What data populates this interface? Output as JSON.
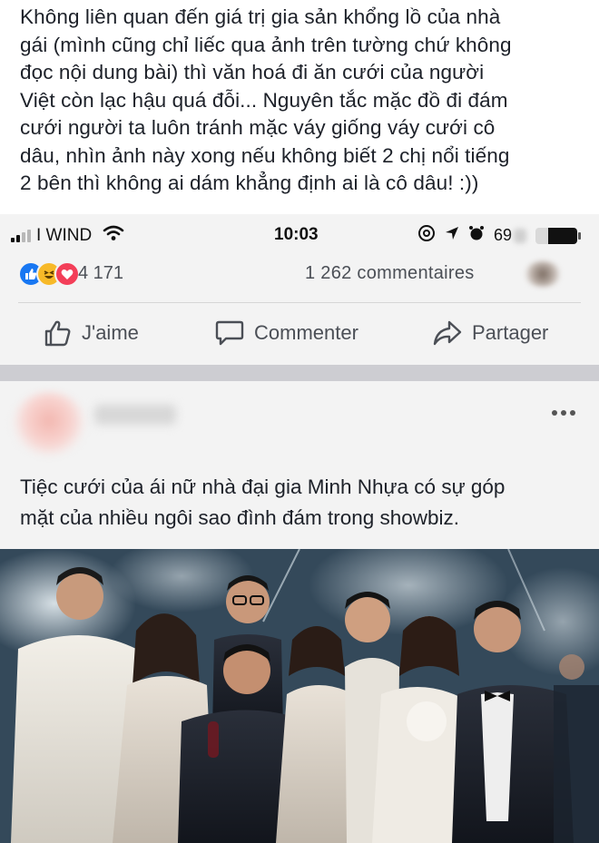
{
  "caption": {
    "line1": "Không liên quan đến giá trị gia sản khổng lồ của nhà",
    "line2": "gái (mình cũng chỉ liếc qua ảnh trên tường chứ không",
    "line3": "đọc nội dung bài) thì văn hoá đi ăn cưới của người",
    "line4": "Việt còn lạc hậu quá đỗi... Nguyên tắc mặc đồ đi đám",
    "line5": "cưới người ta luôn tránh mặc váy giống váy cưới cô",
    "line6": "dâu, nhìn ảnh này xong nếu không biết 2 chị nổi tiếng",
    "line7": "2 bên thì không ai dám khẳng định ai là cô dâu! :))"
  },
  "status_bar": {
    "carrier": "I WIND",
    "time": "10:03",
    "battery_text": "69",
    "icons": [
      "signal-icon",
      "wifi-icon",
      "at-icon",
      "location-arrow-icon",
      "alarm-icon",
      "battery-icon"
    ]
  },
  "reactions": {
    "count": "4 171",
    "comments": "1 262 commentaires",
    "icons": [
      "like-reaction-icon",
      "haha-reaction-icon",
      "love-reaction-icon"
    ]
  },
  "actions": {
    "like": "J'aime",
    "comment": "Commenter",
    "share": "Partager"
  },
  "post": {
    "text_line1": "Tiệc cưới của ái nữ nhà đại gia Minh Nhựa có sự góp",
    "text_line2": "mặt của nhiều ngôi sao đình đám trong showbiz."
  },
  "colors": {
    "facebook_blue": "#1877f2",
    "haha_yellow": "#f7b928",
    "love_red": "#f33e58",
    "text_gray": "#4b4f56",
    "background": "#f3f3f3"
  }
}
